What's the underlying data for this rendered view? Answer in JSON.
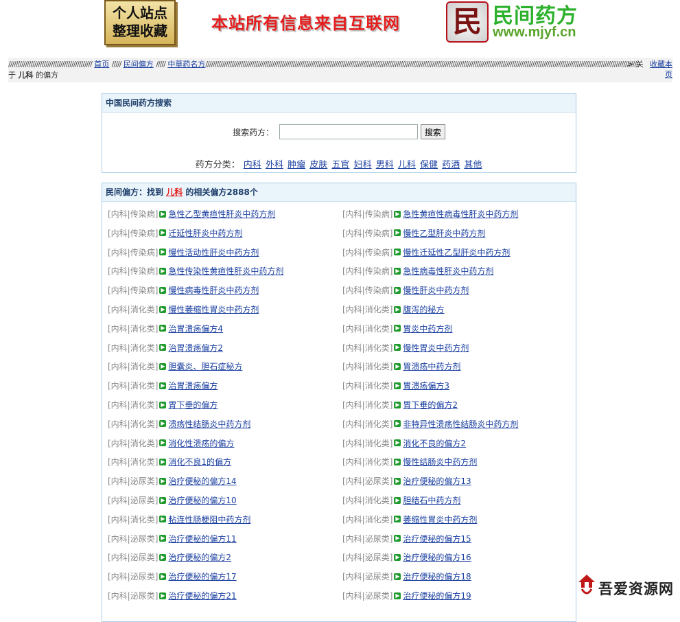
{
  "header": {
    "logo_line1": "个人站点",
    "logo_line2": "整理收藏",
    "banner": "本站所有信息来自互联网",
    "emblem_char": "民",
    "brand_title": "民间药方",
    "brand_url": "www.mjyf.cn"
  },
  "breadcrumb": {
    "slashes_lead": "/////////////////////////////////////////////",
    "home": "首页",
    "sep1": "/////",
    "folk": "民间偏方",
    "sep2": "/////",
    "herbal": "中草药名方",
    "slashes_trail": "/////////////////////////////////////////////////////////////////////////////////////////////////////////////////////////////////////////////////////////////////////////////////////////////////////////////////////////////////////////////////////////////////////////////////////////////////////////////////////////////////////////////",
    "tail_start": "> 关",
    "tail_rest": "于",
    "keyword": "儿科",
    "tail_end": "的偏方",
    "favorite": "收藏本页"
  },
  "search": {
    "panel_title": "中国民间药方搜索",
    "label": "搜索药方：",
    "input_value": "",
    "button": "搜索",
    "categories_label": "药方分类：",
    "categories": [
      "内科",
      "外科",
      "肿瘤",
      "皮肤",
      "五官",
      "妇科",
      "男科",
      "儿科",
      "保健",
      "药酒",
      "其他"
    ]
  },
  "results": {
    "prefix": "民间偏方",
    "found": "：找到",
    "keyword": "儿科",
    "suffix": "的相关偏方2888个",
    "items": [
      {
        "cat": "[内科|传染病]",
        "title": "急性乙型黄疸性肝炎中药方剂"
      },
      {
        "cat": "[内科|传染病]",
        "title": "急性黄疸性病毒性肝炎中药方剂"
      },
      {
        "cat": "[内科|传染病]",
        "title": "迁延性肝炎中药方剂"
      },
      {
        "cat": "[内科|传染病]",
        "title": "慢性乙型肝炎中药方剂"
      },
      {
        "cat": "[内科|传染病]",
        "title": "慢性活动性肝炎中药方剂"
      },
      {
        "cat": "[内科|传染病]",
        "title": "慢性迁延性乙型肝炎中药方剂"
      },
      {
        "cat": "[内科|传染病]",
        "title": "急性传染性黄疸性肝炎中药方剂"
      },
      {
        "cat": "[内科|传染病]",
        "title": "急性病毒性肝炎中药方剂"
      },
      {
        "cat": "[内科|传染病]",
        "title": "慢性病毒性肝炎中药方剂"
      },
      {
        "cat": "[内科|传染病]",
        "title": "慢性肝炎中药方剂"
      },
      {
        "cat": "[内科|消化类]",
        "title": "慢性萎缩性胃炎中药方剂"
      },
      {
        "cat": "[内科|消化类]",
        "title": "腹泻的秘方"
      },
      {
        "cat": "[内科|消化类]",
        "title": "治胃溃疡偏方4"
      },
      {
        "cat": "[内科|消化类]",
        "title": "胃炎中药方剂"
      },
      {
        "cat": "[内科|消化类]",
        "title": "治胃溃疡偏方2"
      },
      {
        "cat": "[内科|消化类]",
        "title": "慢性胃炎中药方剂"
      },
      {
        "cat": "[内科|消化类]",
        "title": "胆囊炎、胆石症秘方"
      },
      {
        "cat": "[内科|消化类]",
        "title": "胃溃疡中药方剂"
      },
      {
        "cat": "[内科|消化类]",
        "title": "治胃溃疡偏方"
      },
      {
        "cat": "[内科|消化类]",
        "title": "胃溃疡偏方3"
      },
      {
        "cat": "[内科|消化类]",
        "title": "胃下垂的偏方"
      },
      {
        "cat": "[内科|消化类]",
        "title": "胃下垂的偏方2"
      },
      {
        "cat": "[内科|消化类]",
        "title": "溃疡性结肠炎中药方剂"
      },
      {
        "cat": "[内科|消化类]",
        "title": "非特异性溃疡性结肠炎中药方剂"
      },
      {
        "cat": "[内科|消化类]",
        "title": "消化性溃疡的偏方"
      },
      {
        "cat": "[内科|消化类]",
        "title": "消化不良的偏方2"
      },
      {
        "cat": "[内科|消化类]",
        "title": "消化不良1的偏方"
      },
      {
        "cat": "[内科|消化类]",
        "title": "慢性结肠炎中药方剂"
      },
      {
        "cat": "[内科|泌尿类]",
        "title": "治疗便秘的偏方14"
      },
      {
        "cat": "[内科|泌尿类]",
        "title": "治疗便秘的偏方13"
      },
      {
        "cat": "[内科|泌尿类]",
        "title": "治疗便秘的偏方10"
      },
      {
        "cat": "[内科|消化类]",
        "title": "胆结石中药方剂"
      },
      {
        "cat": "[内科|消化类]",
        "title": "粘连性肠梗阻中药方剂"
      },
      {
        "cat": "[内科|消化类]",
        "title": "萎缩性胃炎中药方剂"
      },
      {
        "cat": "[内科|泌尿类]",
        "title": "治疗便秘的偏方11"
      },
      {
        "cat": "[内科|泌尿类]",
        "title": "治疗便秘的偏方15"
      },
      {
        "cat": "[内科|泌尿类]",
        "title": "治疗便秘的偏方2"
      },
      {
        "cat": "[内科|泌尿类]",
        "title": "治疗便秘的偏方16"
      },
      {
        "cat": "[内科|泌尿类]",
        "title": "治疗便秘的偏方17"
      },
      {
        "cat": "[内科|泌尿类]",
        "title": "治疗便秘的偏方18"
      },
      {
        "cat": "[内科|泌尿类]",
        "title": "治疗便秘的偏方21"
      },
      {
        "cat": "[内科|泌尿类]",
        "title": "治疗便秘的偏方19"
      }
    ]
  },
  "watermark": {
    "text": "吾爱资源网"
  }
}
